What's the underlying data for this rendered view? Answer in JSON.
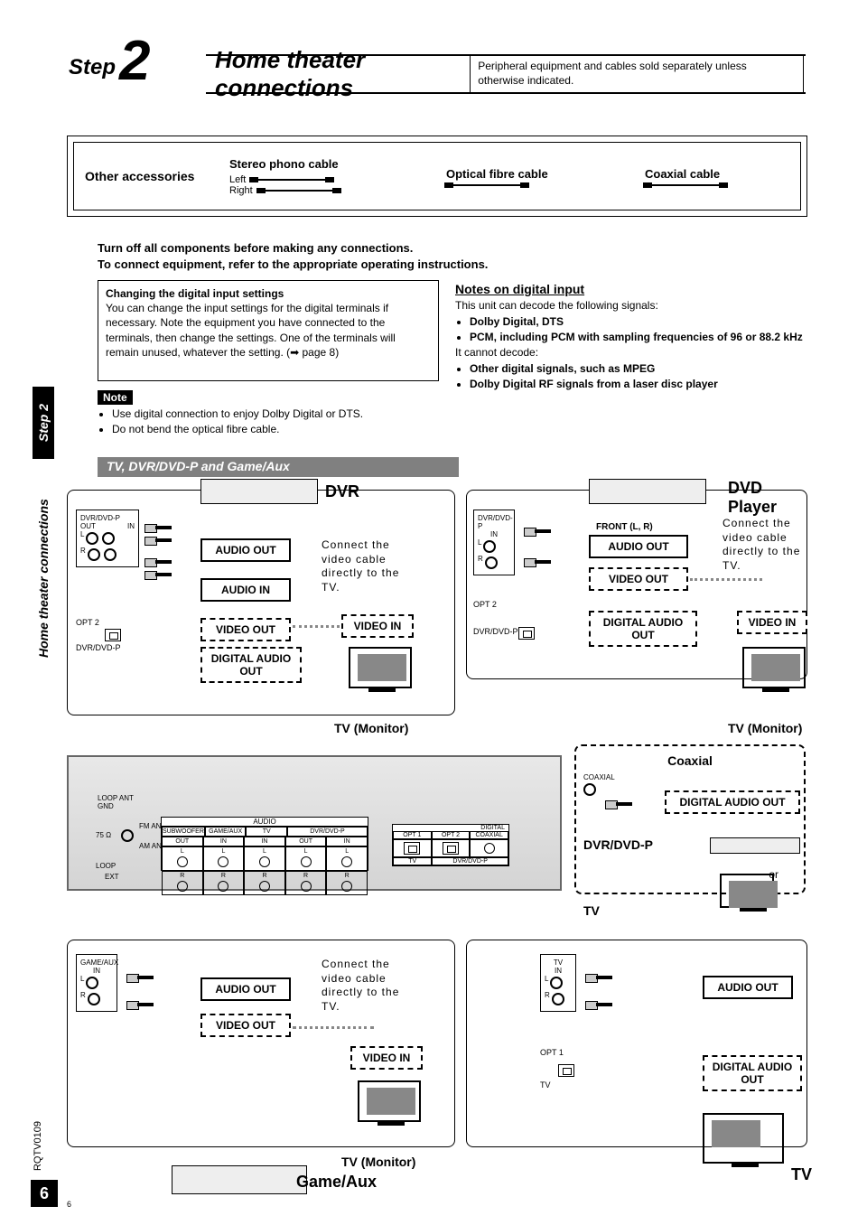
{
  "header": {
    "step_word": "Step",
    "step_number": "2",
    "title": "Home theater connections",
    "peripheral_note": "Peripheral equipment and cables sold separately unless otherwise indicated."
  },
  "accessories": {
    "title": "Other accessories",
    "stereo": "Stereo phono cable",
    "left": "Left",
    "right": "Right",
    "optical": "Optical fibre cable",
    "coaxial": "Coaxial cable"
  },
  "warnings": {
    "line1": "Turn off all components before making any connections.",
    "line2": "To connect equipment, refer to the appropriate operating instructions."
  },
  "digital_settings": {
    "heading": "Changing the digital input settings",
    "body": "You can change the input settings for the digital terminals if necessary. Note the equipment you have connected to the terminals, then change the settings. One of the terminals will remain unused, whatever the setting. (➡ page 8)"
  },
  "note": {
    "badge": "Note",
    "item1": "Use digital connection to enjoy Dolby Digital or DTS.",
    "item2": "Do not bend the optical fibre cable."
  },
  "notes_right": {
    "heading": "Notes on digital input",
    "intro": "This unit can decode the following signals:",
    "b1": "Dolby Digital, DTS",
    "b2": "PCM, including PCM with sampling frequencies of 96 or 88.2 kHz",
    "cannot": "It cannot decode:",
    "b3": "Other digital signals, such as MPEG",
    "b4": "Dolby Digital RF signals from a laser disc player"
  },
  "side": {
    "step2": "Step 2",
    "htc": "Home theater connections"
  },
  "section_bar": "TV, DVR/DVD-P and Game/Aux",
  "dvr": {
    "label": "DVR",
    "ports_title": "DVR/DVD-P",
    "out": "OUT",
    "in": "IN",
    "l": "L",
    "r": "R",
    "opt2": "OPT 2",
    "audio_out": "AUDIO OUT",
    "audio_in": "AUDIO IN",
    "video_out": "VIDEO OUT",
    "digital_audio_out": "DIGITAL AUDIO OUT",
    "connect": "Connect the video cable directly to the TV.",
    "video_in": "VIDEO IN",
    "tv_mon": "TV (Monitor)"
  },
  "dvd": {
    "label": "DVD Player",
    "ports_title": "DVR/DVD-P",
    "in": "IN",
    "l": "L",
    "r": "R",
    "opt2": "OPT 2",
    "dvrdvdp": "DVR/DVD-P",
    "front_lr": "FRONT (L, R)",
    "audio_out": "AUDIO OUT",
    "video_out": "VIDEO OUT",
    "digital_audio_out": "DIGITAL AUDIO OUT",
    "connect": "Connect the video cable directly to the TV.",
    "video_in": "VIDEO IN",
    "tv_mon": "TV (Monitor)"
  },
  "coax": {
    "title": "Coaxial",
    "coaxial": "COAXIAL",
    "digital_audio_out": "DIGITAL AUDIO OUT",
    "dvrdvdp": "DVR/DVD-P",
    "or": "or",
    "tv": "TV"
  },
  "receiver": {
    "loop_ant": "LOOP ANT",
    "gnd": "GND",
    "75ohm": "75 Ω",
    "fm_ant": "FM ANT",
    "am_ant": "AM ANT",
    "loop": "LOOP",
    "ext": "EXT",
    "audio": "AUDIO",
    "subwoofer": "SUBWOOFER",
    "gameaux": "GAME/AUX",
    "tv": "TV",
    "dvrdvdp": "DVR/DVD-P",
    "out": "OUT",
    "in": "IN",
    "l": "L",
    "r": "R",
    "digital": "DIGITAL",
    "opt1": "OPT 1",
    "opt2": "OPT 2",
    "coaxial": "COAXIAL"
  },
  "gameaux": {
    "title": "GAME/AUX",
    "in": "IN",
    "l": "L",
    "r": "R",
    "audio_out": "AUDIO OUT",
    "video_out": "VIDEO OUT",
    "connect": "Connect the video cable directly to the TV.",
    "video_in": "VIDEO IN",
    "tv_mon": "TV (Monitor)",
    "label": "Game/Aux"
  },
  "tvbox": {
    "title": "TV",
    "in": "IN",
    "l": "L",
    "r": "R",
    "opt1": "OPT 1",
    "tv": "TV",
    "audio_out": "AUDIO OUT",
    "digital_audio_out": "DIGITAL AUDIO OUT",
    "label": "TV"
  },
  "footer": {
    "doc_code": "RQTV0109",
    "page_big": "6",
    "page_small": "6"
  }
}
